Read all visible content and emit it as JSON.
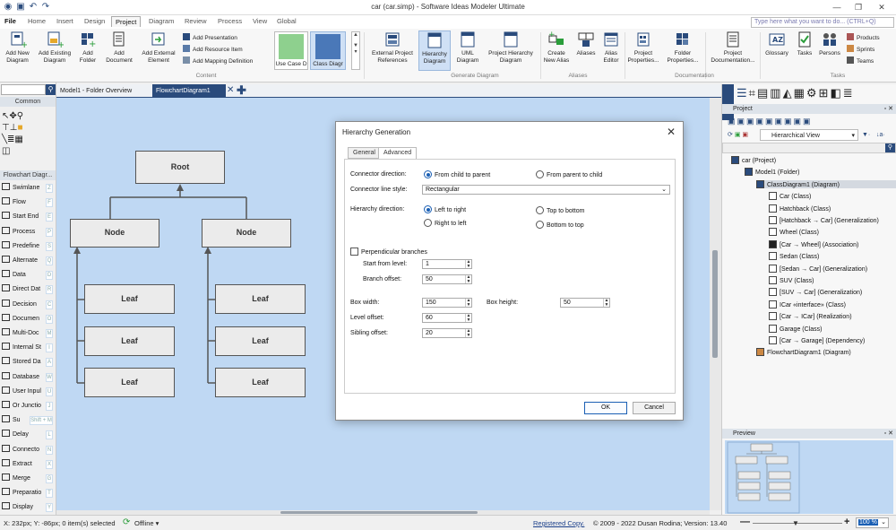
{
  "window": {
    "title": "car (car.simp)  - Software Ideas Modeler Ultimate",
    "search_placeholder": "Type here what you want to do... (CTRL+Q)"
  },
  "menu_tabs": [
    "File",
    "Home",
    "Insert",
    "Design",
    "Project",
    "Diagram",
    "Review",
    "Process",
    "View",
    "Global"
  ],
  "ribbon": {
    "add_new_diagram": "Add New\nDiagram",
    "add_existing_diagram": "Add Existing\nDiagram",
    "add_folder": "Add\nFolder",
    "add_document": "Add\nDocument",
    "add_external_element": "Add External\nElement",
    "add_presentation": "Add Presentation",
    "add_resource_item": "Add Resource Item",
    "add_mapping_definition": "Add Mapping Definition",
    "use_case_d": "Use Case D",
    "class_diagr": "Class Diagr",
    "group_content": "Content",
    "external_project_references": "External Project\nReferences",
    "hierarchy_diagram": "Hierarchy\nDiagram",
    "uml_diagram": "UML\nDiagram",
    "project_hierarchy_diagram": "Project Hierarchy\nDiagram",
    "group_generate": "Generate Diagram",
    "create_new_alias": "Create\nNew Alias",
    "aliases": "Aliases",
    "alias_editor": "Alias\nEditor",
    "group_aliases": "Aliases",
    "project_properties": "Project\nProperties...",
    "folder_properties": "Folder\nProperties...",
    "project_documentation": "Project\nDocumentation...",
    "group_documentation": "Documentation",
    "glossary": "Glossary",
    "tasks": "Tasks",
    "persons": "Persons",
    "products": "Products",
    "sprints": "Sprints",
    "teams": "Teams",
    "group_tasks": "Tasks"
  },
  "toolbox": {
    "common_header": "Common",
    "flowchart_header": "Flowchart Diagr...",
    "items": [
      {
        "label": "Swimlane",
        "key": "Z"
      },
      {
        "label": "Flow",
        "key": "F"
      },
      {
        "label": "Start End",
        "key": "E"
      },
      {
        "label": "Process",
        "key": "P"
      },
      {
        "label": "Predefine",
        "key": "S"
      },
      {
        "label": "Alternate",
        "key": "Q"
      },
      {
        "label": "Data",
        "key": "D"
      },
      {
        "label": "Direct Dat",
        "key": "R"
      },
      {
        "label": "Decision",
        "key": "C"
      },
      {
        "label": "Documen",
        "key": "O"
      },
      {
        "label": "Multi-Doc",
        "key": "M"
      },
      {
        "label": "Internal St",
        "key": "I"
      },
      {
        "label": "Stored Da",
        "key": "A"
      },
      {
        "label": "Database",
        "key": "W"
      },
      {
        "label": "User Inpul",
        "key": "U"
      },
      {
        "label": "Or Junctio",
        "key": "J"
      },
      {
        "label": "Su",
        "key": "Shift + M"
      },
      {
        "label": "Delay",
        "key": "L"
      },
      {
        "label": "Connecto",
        "key": "N"
      },
      {
        "label": "Extract",
        "key": "X"
      },
      {
        "label": "Merge",
        "key": "G"
      },
      {
        "label": "Preparatio",
        "key": "T"
      },
      {
        "label": "Display",
        "key": "Y"
      }
    ]
  },
  "doc_tabs": [
    "Model1 - Folder Overview",
    "FlowchartDiagram1"
  ],
  "diagram": {
    "root": "Root",
    "node": "Node",
    "leaf": "Leaf"
  },
  "dialog": {
    "title": "Hierarchy Generation",
    "tab_general": "General",
    "tab_advanced": "Advanced",
    "connector_direction_label": "Connector direction:",
    "from_child_to_parent": "From child to parent",
    "from_parent_to_child": "From parent to child",
    "connector_line_style_label": "Connector line style:",
    "connector_line_style_value": "Rectangular",
    "hierarchy_direction_label": "Hierarchy direction:",
    "left_to_right": "Left to right",
    "right_to_left": "Right to left",
    "top_to_bottom": "Top to bottom",
    "bottom_to_top": "Bottom to top",
    "perpendicular_branches": "Perpendicular branches",
    "start_from_level_label": "Start from level:",
    "start_from_level": "1",
    "branch_offset_label": "Branch offset:",
    "branch_offset": "50",
    "box_width_label": "Box width:",
    "box_width": "150",
    "box_height_label": "Box height:",
    "box_height": "50",
    "level_offset_label": "Level offset:",
    "level_offset": "60",
    "sibling_offset_label": "Sibling offset:",
    "sibling_offset": "20",
    "ok": "OK",
    "cancel": "Cancel"
  },
  "project_panel": {
    "header": "Project",
    "view_mode": "Hierarchical View",
    "tree": [
      "car (Project)",
      "Model1 (Folder)",
      "ClassDiagram1 (Diagram)",
      "Car (Class)",
      "Hatchback (Class)",
      "[Hatchback → Car] (Generalization)",
      "Wheel (Class)",
      "[Car → Wheel] (Association)",
      "Sedan (Class)",
      "[Sedan → Car] (Generalization)",
      "SUV (Class)",
      "[SUV → Car] (Generalization)",
      "ICar «interface» (Class)",
      "[Car → ICar] (Realization)",
      "Garage (Class)",
      "[Car → Garage] (Dependency)",
      "FlowchartDiagram1 (Diagram)"
    ],
    "preview_header": "Preview"
  },
  "statusbar": {
    "coords": "X: 232px; Y: -86px; 0 item(s) selected",
    "offline": "Offline",
    "registered": "Registered Copy.",
    "copyright": "© 2009 - 2022 Dusan Rodina; Version: 13.40",
    "zoom": "100 %"
  }
}
